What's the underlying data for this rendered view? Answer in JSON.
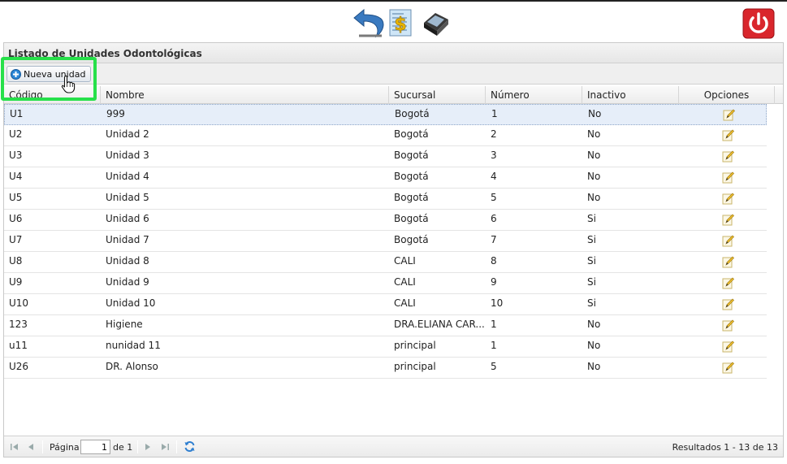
{
  "toolbar_icons": {
    "back": "back-arrow-icon",
    "money": "money-document-icon",
    "device": "dental-device-icon",
    "power": "power-icon",
    "power_color": "#d9262c"
  },
  "panel": {
    "title": "Listado de Unidades Odontológicas",
    "new_button_label": "Nueva unidad"
  },
  "grid": {
    "columns": [
      "Código",
      "Nombre",
      "Sucursal",
      "Número",
      "Inactivo",
      "Opciones"
    ],
    "rows": [
      {
        "codigo": "U1",
        "nombre": "999",
        "sucursal": "Bogotá",
        "numero": "1",
        "inactivo": "No"
      },
      {
        "codigo": "U2",
        "nombre": "Unidad 2",
        "sucursal": "Bogotá",
        "numero": "2",
        "inactivo": "No"
      },
      {
        "codigo": "U3",
        "nombre": "Unidad 3",
        "sucursal": "Bogotá",
        "numero": "3",
        "inactivo": "No"
      },
      {
        "codigo": "U4",
        "nombre": "Unidad 4",
        "sucursal": "Bogotá",
        "numero": "4",
        "inactivo": "No"
      },
      {
        "codigo": "U5",
        "nombre": "Unidad 5",
        "sucursal": "Bogotá",
        "numero": "5",
        "inactivo": "No"
      },
      {
        "codigo": "U6",
        "nombre": "Unidad 6",
        "sucursal": "Bogotá",
        "numero": "6",
        "inactivo": "Si"
      },
      {
        "codigo": "U7",
        "nombre": "Unidad 7",
        "sucursal": "Bogotá",
        "numero": "7",
        "inactivo": "Si"
      },
      {
        "codigo": "U8",
        "nombre": "Unidad 8",
        "sucursal": "CALI",
        "numero": "8",
        "inactivo": "Si"
      },
      {
        "codigo": "U9",
        "nombre": "Unidad 9",
        "sucursal": "CALI",
        "numero": "9",
        "inactivo": "Si"
      },
      {
        "codigo": "U10",
        "nombre": "Unidad 10",
        "sucursal": "CALI",
        "numero": "10",
        "inactivo": "Si"
      },
      {
        "codigo": "123",
        "nombre": "Higiene",
        "sucursal": "DRA.ELIANA CAR...",
        "numero": "1",
        "inactivo": "No"
      },
      {
        "codigo": "u11",
        "nombre": "nunidad 11",
        "sucursal": "principal",
        "numero": "1",
        "inactivo": "No"
      },
      {
        "codigo": "U26",
        "nombre": "DR. Alonso",
        "sucursal": "principal",
        "numero": "5",
        "inactivo": "No"
      }
    ]
  },
  "pager": {
    "page_label": "Página",
    "page_value": "1",
    "of_label": "de 1",
    "results": "Resultados 1 - 13 de 13"
  },
  "colors": {
    "highlight": "#27e04a",
    "selected_row": "#e6eef9"
  }
}
